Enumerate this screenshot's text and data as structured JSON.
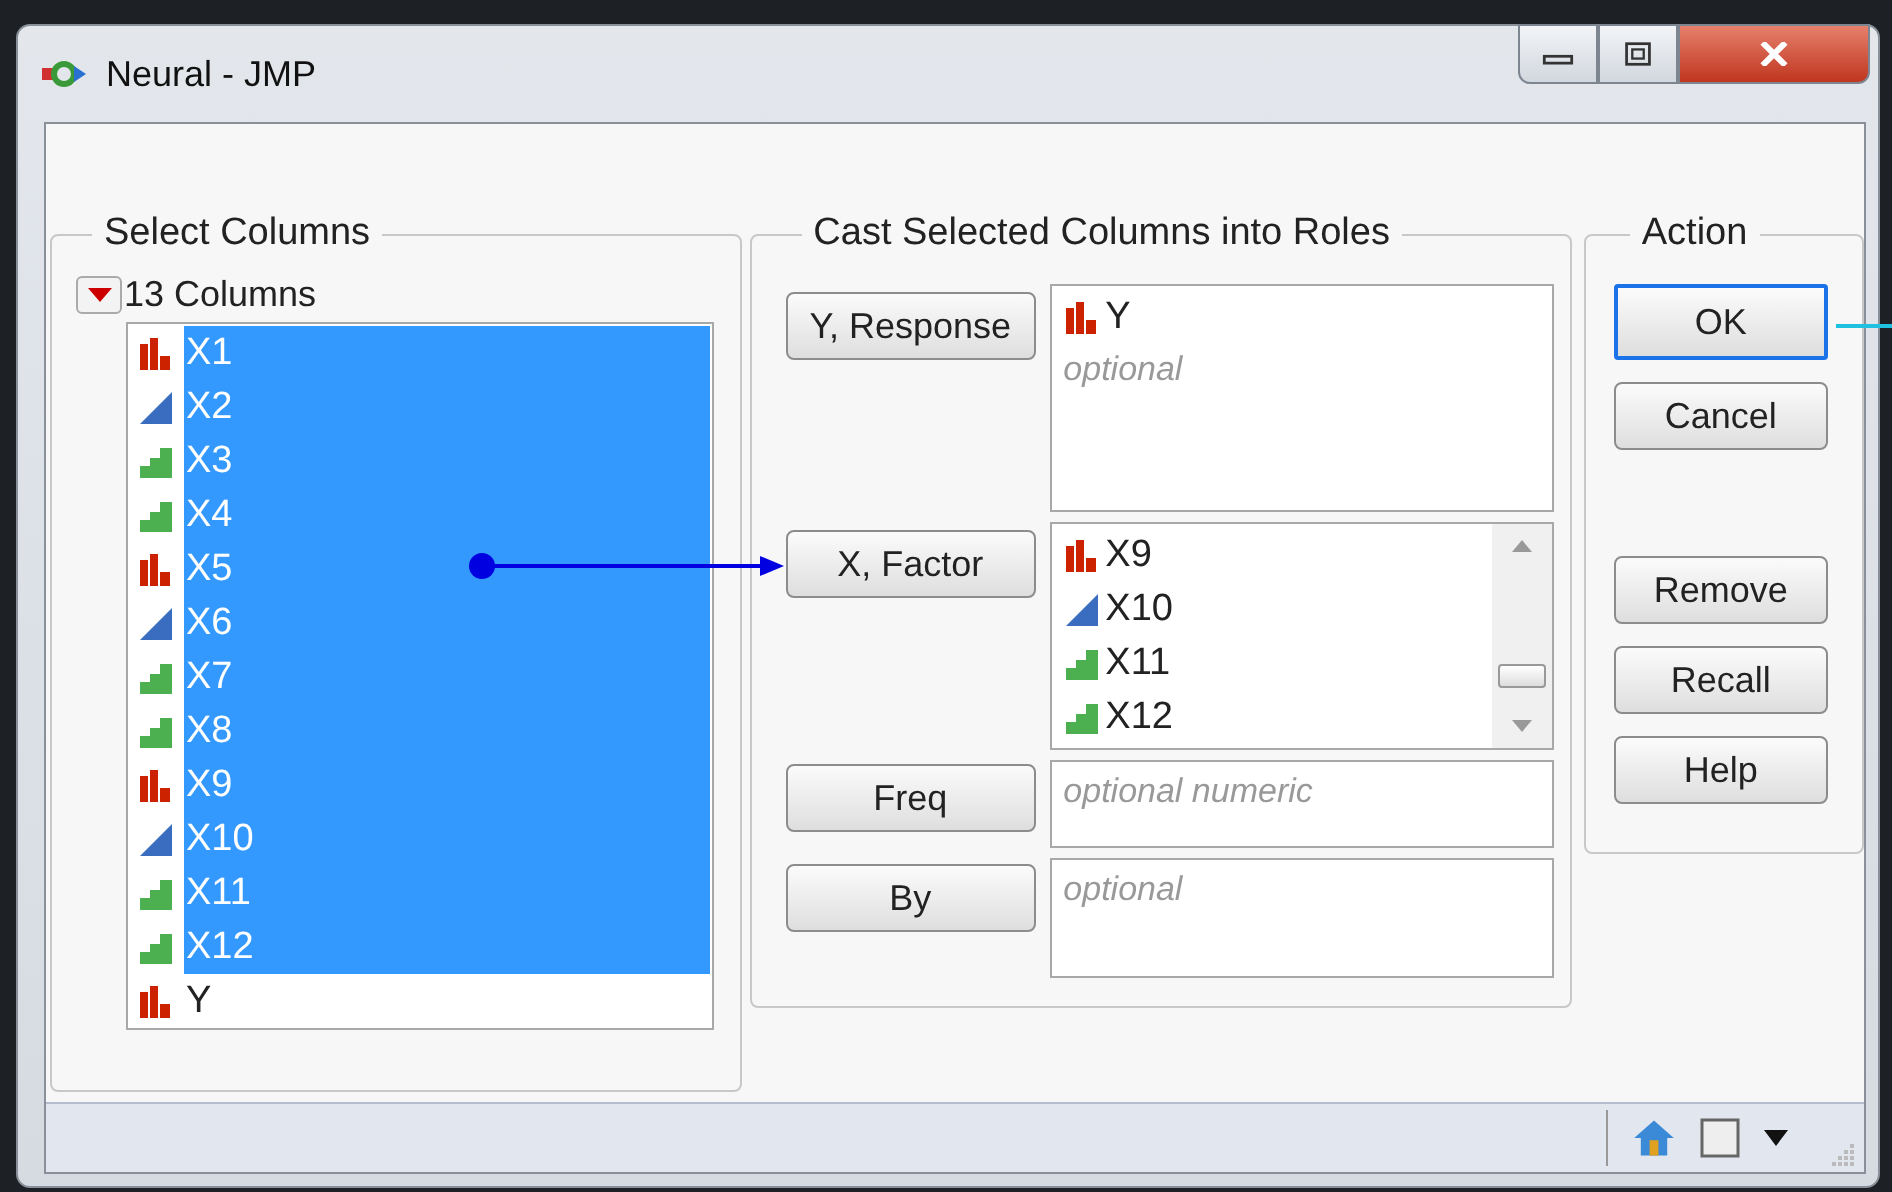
{
  "window": {
    "title": "Neural - JMP"
  },
  "select_columns": {
    "title": "Select Columns",
    "count_label": "13 Columns",
    "columns": [
      {
        "name": "X1",
        "kind": "nominal",
        "selected": true
      },
      {
        "name": "X2",
        "kind": "continuous",
        "selected": true
      },
      {
        "name": "X3",
        "kind": "ordinal",
        "selected": true
      },
      {
        "name": "X4",
        "kind": "ordinal",
        "selected": true
      },
      {
        "name": "X5",
        "kind": "nominal",
        "selected": true
      },
      {
        "name": "X6",
        "kind": "continuous",
        "selected": true
      },
      {
        "name": "X7",
        "kind": "ordinal",
        "selected": true
      },
      {
        "name": "X8",
        "kind": "ordinal",
        "selected": true
      },
      {
        "name": "X9",
        "kind": "nominal",
        "selected": true
      },
      {
        "name": "X10",
        "kind": "continuous",
        "selected": true
      },
      {
        "name": "X11",
        "kind": "ordinal",
        "selected": true
      },
      {
        "name": "X12",
        "kind": "ordinal",
        "selected": true
      },
      {
        "name": "Y",
        "kind": "nominal",
        "selected": false
      }
    ]
  },
  "cast_roles": {
    "title": "Cast Selected Columns into Roles",
    "roles": [
      {
        "button": "Y, Response",
        "columns": [
          {
            "name": "Y",
            "kind": "nominal"
          }
        ],
        "placeholder": "optional"
      },
      {
        "button": "X, Factor",
        "columns": [
          {
            "name": "X9",
            "kind": "nominal"
          },
          {
            "name": "X10",
            "kind": "continuous"
          },
          {
            "name": "X11",
            "kind": "ordinal"
          },
          {
            "name": "X12",
            "kind": "ordinal"
          }
        ]
      },
      {
        "button": "Freq",
        "placeholder": "optional numeric"
      },
      {
        "button": "By",
        "placeholder": "optional"
      }
    ]
  },
  "action": {
    "title": "Action",
    "button_groups": [
      [
        {
          "label": "OK",
          "focused": true
        },
        {
          "label": "Cancel",
          "focused": false
        }
      ],
      [
        {
          "label": "Remove",
          "focused": false
        },
        {
          "label": "Recall",
          "focused": false
        },
        {
          "label": "Help",
          "focused": false
        }
      ]
    ]
  }
}
